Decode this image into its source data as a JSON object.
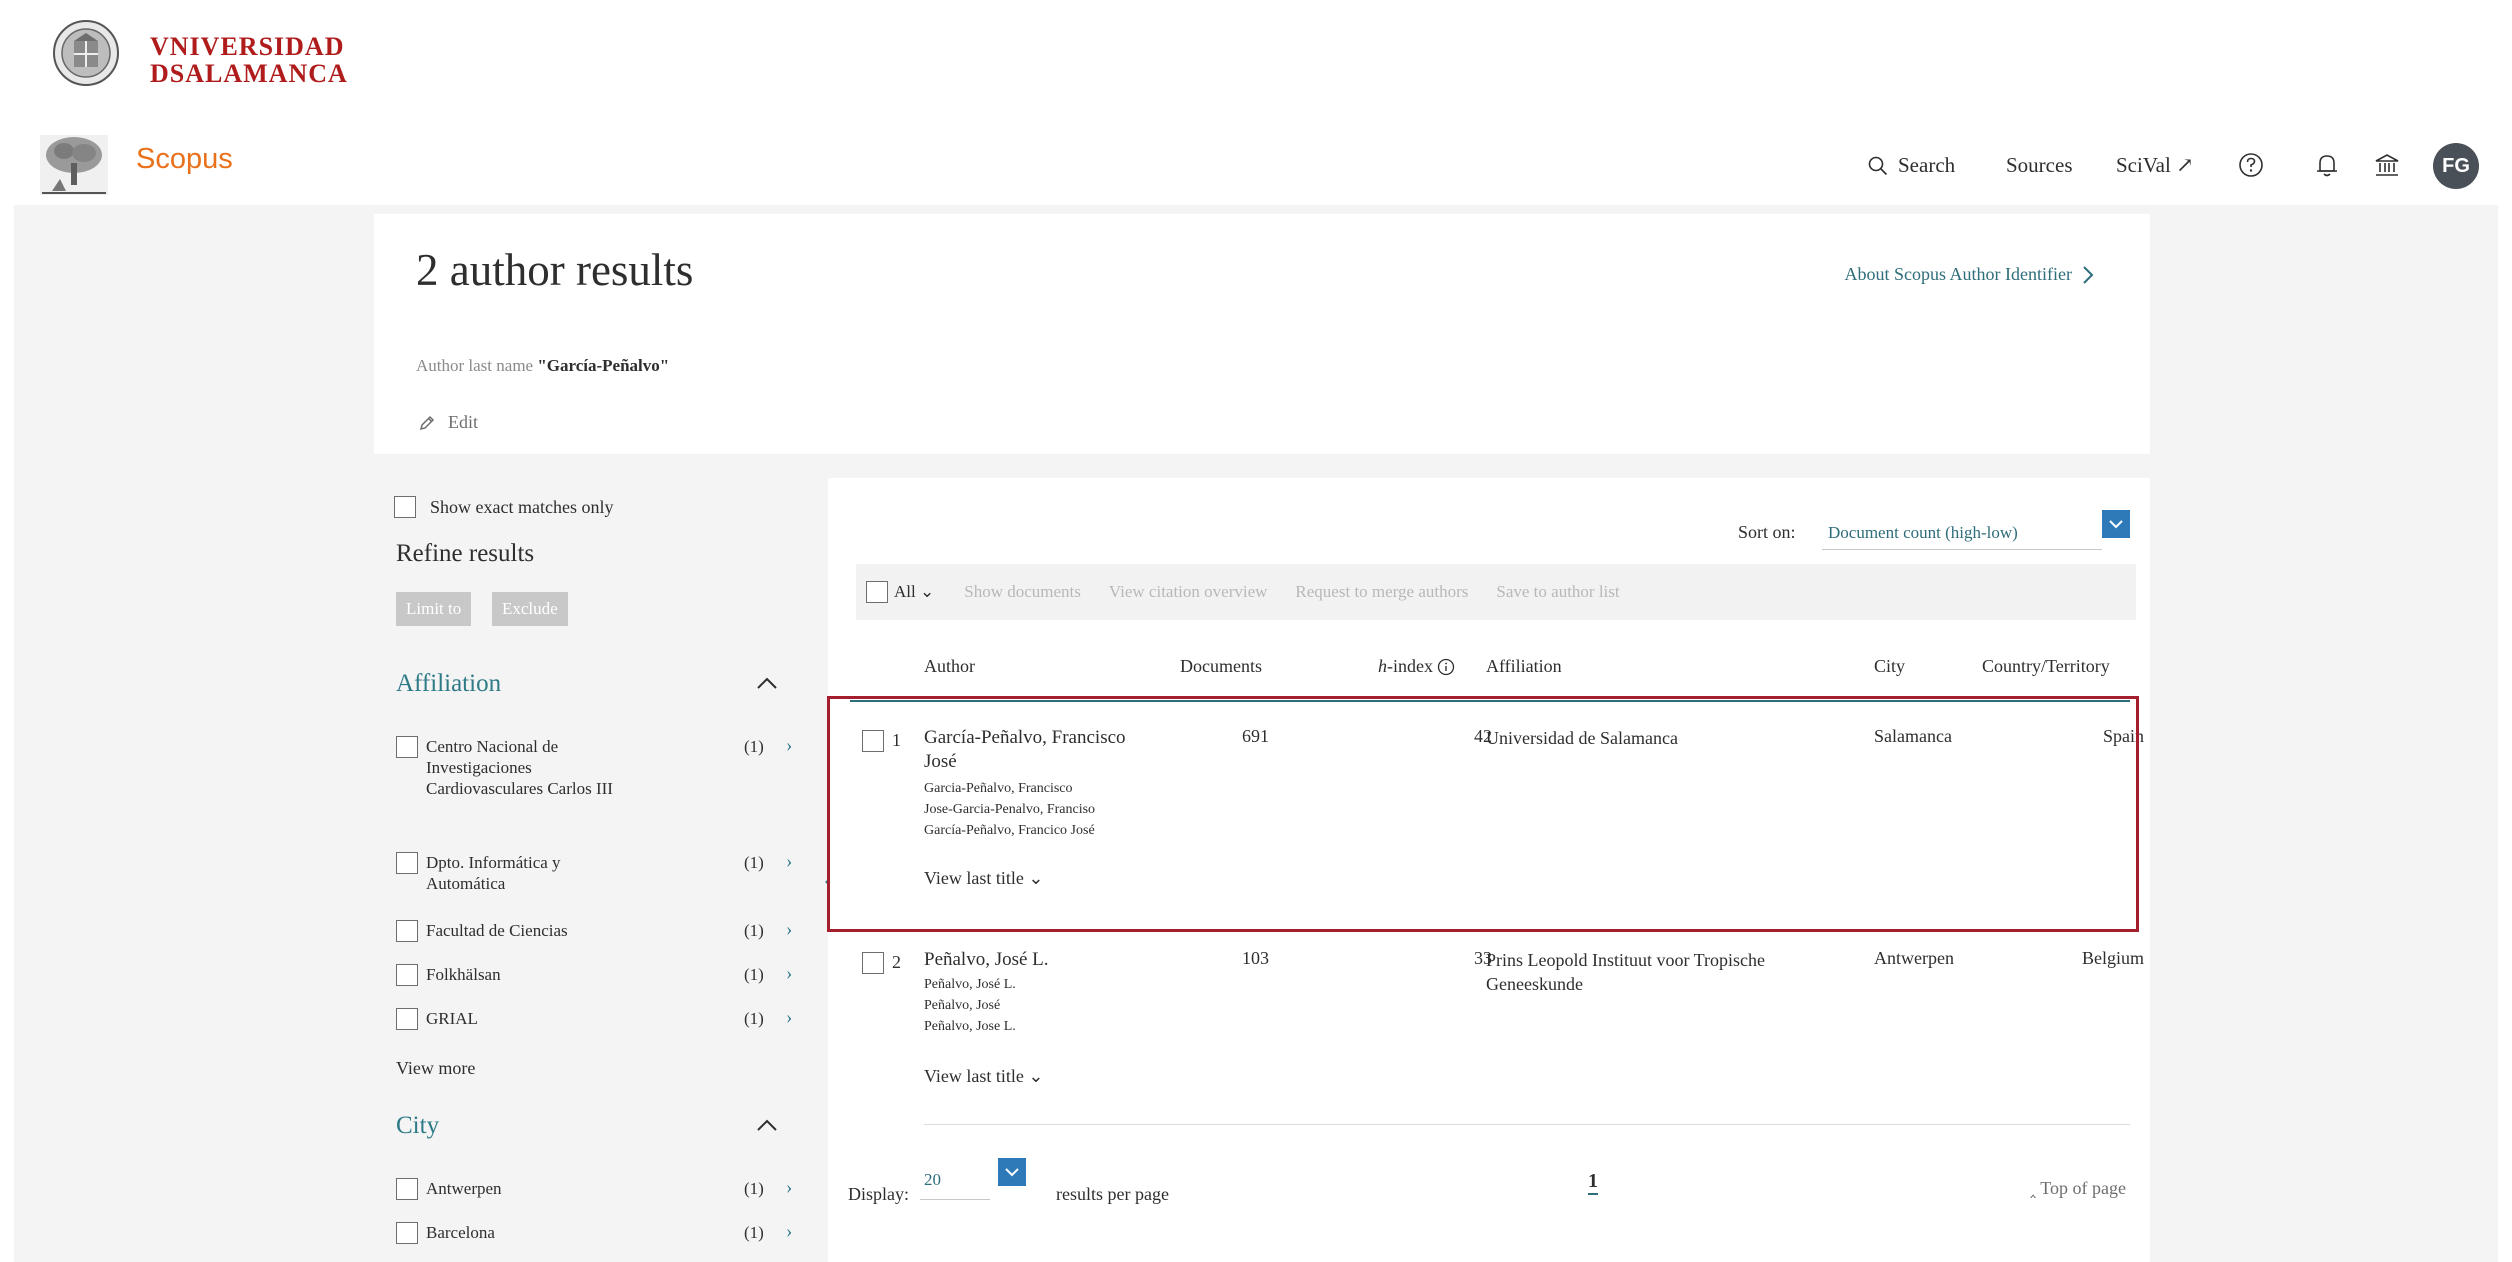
{
  "university": {
    "name_line1": "VNIVERSIDAD",
    "name_line2": "DSALAMANCA"
  },
  "nav": {
    "brand": "Scopus",
    "search": "Search",
    "sources": "Sources",
    "scival": "SciVal ↗",
    "avatar_initials": "FG",
    "icons": [
      "search-icon",
      "help-icon",
      "bell-icon",
      "institution-icon"
    ]
  },
  "header": {
    "title": "2 author results",
    "about_link": "About Scopus Author Identifier",
    "query_label": "Author last name ",
    "query_value": "\"García-Peñalvo\"",
    "edit": "Edit"
  },
  "sidebar": {
    "exact_matches": "Show exact matches only",
    "refine_title": "Refine results",
    "limit_to": "Limit to",
    "exclude": "Exclude",
    "affiliation_title": "Affiliation",
    "affiliations": [
      {
        "label": "Centro Nacional de Investigaciones Cardiovasculares Carlos III",
        "count": "(1)"
      },
      {
        "label": "Dpto. Informática y Automática",
        "count": "(1)"
      },
      {
        "label": "Facultad de Ciencias",
        "count": "(1)"
      },
      {
        "label": "Folkhälsan",
        "count": "(1)"
      },
      {
        "label": "GRIAL",
        "count": "(1)"
      }
    ],
    "view_more": "View more",
    "city_title": "City",
    "cities": [
      {
        "label": "Antwerpen",
        "count": "(1)"
      },
      {
        "label": "Barcelona",
        "count": "(1)"
      }
    ]
  },
  "results": {
    "sort_label": "Sort on:",
    "sort_value": "Document count (high-low)",
    "toolbar": {
      "all": "All",
      "show_documents": "Show documents",
      "view_citation": "View citation overview",
      "request_merge": "Request to merge authors",
      "save_to_list": "Save to author list"
    },
    "columns": {
      "author": "Author",
      "documents": "Documents",
      "hindex_prefix": "h",
      "hindex_suffix": "-index",
      "affiliation": "Affiliation",
      "city": "City",
      "country": "Country/Territory"
    },
    "rows": [
      {
        "num": "1",
        "name": "García-Peñalvo, Francisco José",
        "variants": [
          "Garcia-Peñalvo, Francisco",
          "Jose-Garcia-Penalvo, Franciso",
          "García-Peñalvo, Francico José"
        ],
        "documents": "691",
        "hindex": "42",
        "affiliation": "Universidad de Salamanca",
        "city": "Salamanca",
        "country": "Spain",
        "view_last": "View last title"
      },
      {
        "num": "2",
        "name": "Peñalvo, José L.",
        "variants": [
          "Peñalvo, José L.",
          "Peñalvo, José",
          "Peñalvo, Jose L."
        ],
        "documents": "103",
        "hindex": "33",
        "affiliation": "Prins Leopold Instituut voor Tropische Geneeskunde",
        "city": "Antwerpen",
        "country": "Belgium",
        "view_last": "View last title"
      }
    ],
    "display_label": "Display:",
    "display_value": "20",
    "per_page": "results per page",
    "page": "1",
    "top_of_page": "Top of page"
  },
  "colors": {
    "university_red": "#b01c1c",
    "scopus_orange": "#e9711c",
    "link_teal": "#2e7a87",
    "highlight_red": "#a41e2e",
    "select_blue": "#2e7ab8"
  }
}
